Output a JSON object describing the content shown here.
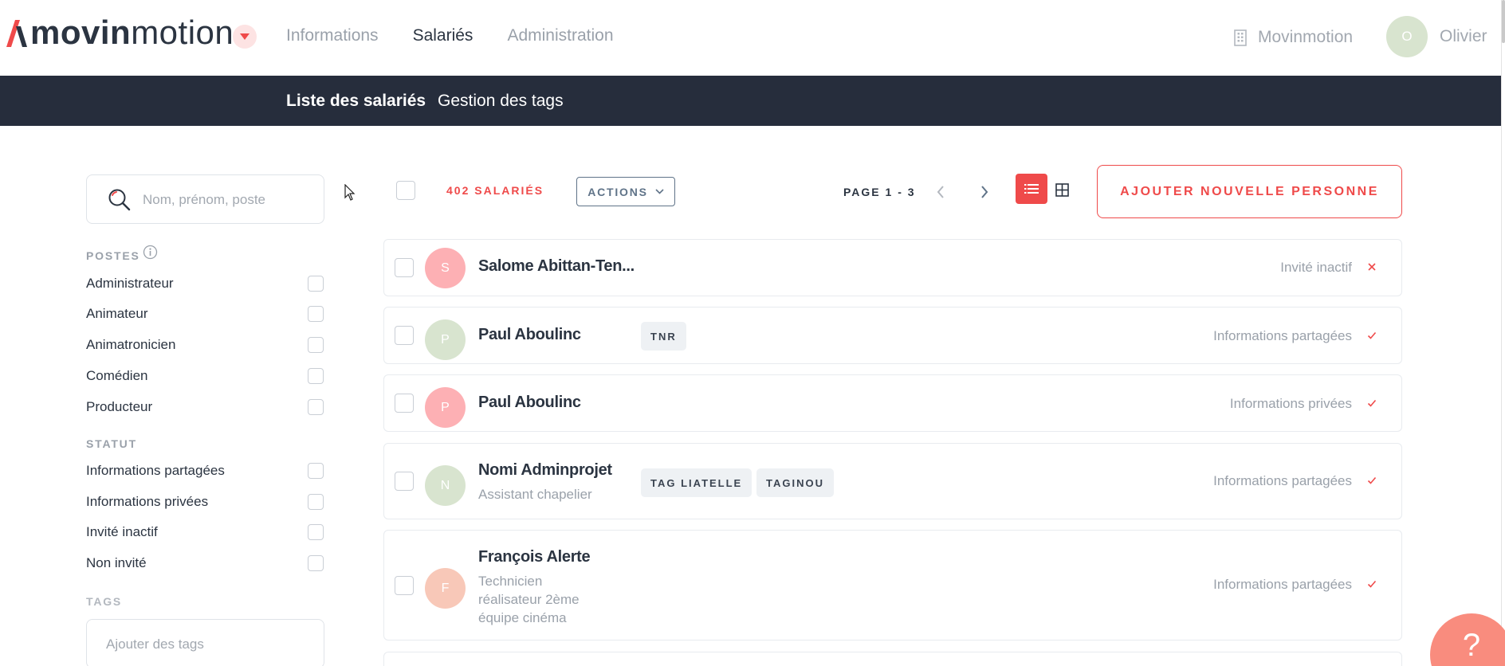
{
  "header": {
    "logo_text_bold": "movin",
    "logo_text_light": "motion",
    "nav": [
      {
        "label": "Informations"
      },
      {
        "label": "Salariés"
      },
      {
        "label": "Administration"
      }
    ],
    "company": "Movinmotion",
    "user": {
      "initial": "O",
      "name": "Olivier"
    }
  },
  "subnav": {
    "tabs": [
      {
        "label": "Liste des salariés"
      },
      {
        "label": "Gestion des tags"
      }
    ]
  },
  "sidebar": {
    "search_placeholder": "Nom, prénom, poste",
    "postes_title": "POSTES",
    "postes": [
      {
        "label": "Administrateur"
      },
      {
        "label": "Animateur"
      },
      {
        "label": "Animatronicien"
      },
      {
        "label": "Comédien"
      },
      {
        "label": "Producteur"
      }
    ],
    "statut_title": "STATUT",
    "statut": [
      {
        "label": "Informations partagées"
      },
      {
        "label": "Informations privées"
      },
      {
        "label": "Invité inactif"
      },
      {
        "label": "Non invité"
      }
    ],
    "tags_title": "TAGS",
    "tags_placeholder": "Ajouter des tags"
  },
  "toolbar": {
    "count": "402 SALARIÉS",
    "actions": "ACTIONS",
    "page": "PAGE 1 - 3",
    "add_button": "AJOUTER NOUVELLE PERSONNE"
  },
  "employees": [
    {
      "initial": "S",
      "avatar_color": "#fdb0b4",
      "name": "Salome Abittan-Ten...",
      "job": "",
      "tags": [],
      "status": "Invité inactif",
      "status_mark": "cross"
    },
    {
      "initial": "P",
      "avatar_color": "#d8e4cf",
      "name": "Paul Aboulinc",
      "job": "",
      "tags": [
        "TNR"
      ],
      "status": "Informations partagées",
      "status_mark": "check"
    },
    {
      "initial": "P",
      "avatar_color": "#fdb0b4",
      "name": "Paul Aboulinc",
      "job": "",
      "tags": [],
      "status": "Informations privées",
      "status_mark": "check"
    },
    {
      "initial": "N",
      "avatar_color": "#d8e4cf",
      "name": "Nomi Adminprojet",
      "job": "Assistant chapelier",
      "tags": [
        "TAG LIATELLE",
        "TAGINOU"
      ],
      "status": "Informations partagées",
      "status_mark": "check"
    },
    {
      "initial": "F",
      "avatar_color": "#f8c8b8",
      "name": "François Alerte",
      "job_lines": [
        "Technicien",
        "réalisateur 2ème",
        "équipe cinéma"
      ],
      "tags": [],
      "status": "Informations partagées",
      "status_mark": "check"
    }
  ],
  "help": "?",
  "colors": {
    "accent": "#ef4a4a",
    "dark_nav": "#262d3c",
    "text": "#2b3441",
    "muted": "#9aa1aa"
  }
}
